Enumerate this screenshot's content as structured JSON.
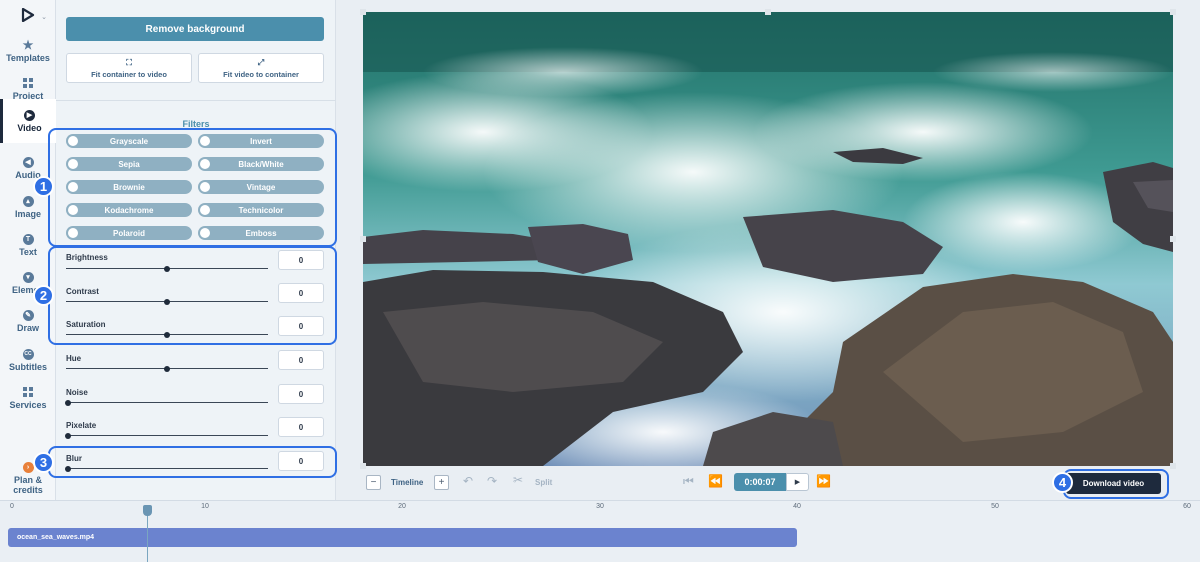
{
  "rail": {
    "items": [
      {
        "label": "Templates",
        "icon": "star-icon"
      },
      {
        "label": "Project",
        "icon": "grid-icon"
      },
      {
        "label": "Video",
        "icon": "play-icon"
      },
      {
        "label": "Audio",
        "icon": "audio-icon"
      },
      {
        "label": "Image",
        "icon": "image-icon"
      },
      {
        "label": "Text",
        "icon": "text-icon"
      },
      {
        "label": "Elemen",
        "icon": "elements-icon"
      },
      {
        "label": "Draw",
        "icon": "draw-icon"
      },
      {
        "label": "Subtitles",
        "icon": "cc-icon"
      },
      {
        "label": "Services",
        "icon": "grid-icon"
      },
      {
        "label": "Plan & credits",
        "icon": "credits-icon"
      }
    ],
    "active": "Video"
  },
  "panel": {
    "remove_bg": "Remove background",
    "fit_container": "Fit container to video",
    "fit_video": "Fit video to container",
    "filters_title": "Filters",
    "filters": [
      "Grayscale",
      "Invert",
      "Sepia",
      "Black/White",
      "Brownie",
      "Vintage",
      "Kodachrome",
      "Technicolor",
      "Polaroid",
      "Emboss"
    ],
    "sliders": {
      "brightness": {
        "label": "Brightness",
        "value": "0"
      },
      "contrast": {
        "label": "Contrast",
        "value": "0"
      },
      "saturation": {
        "label": "Saturation",
        "value": "0"
      },
      "hue": {
        "label": "Hue",
        "value": "0"
      },
      "noise": {
        "label": "Noise",
        "value": "0"
      },
      "pixelate": {
        "label": "Pixelate",
        "value": "0"
      },
      "blur": {
        "label": "Blur",
        "value": "0"
      }
    }
  },
  "annotations": [
    "1",
    "2",
    "3",
    "4"
  ],
  "controls": {
    "minus": "−",
    "plus": "+",
    "timeline_label": "Timeline",
    "split_label": "Split",
    "time": "0:00:07",
    "download": "Download video"
  },
  "timeline": {
    "ticks": [
      "0",
      "10",
      "20",
      "30",
      "40",
      "50",
      "60"
    ],
    "clip_name": "ocean_sea_waves.mp4"
  },
  "colors": {
    "accent": "#4b8fac",
    "annotation": "#2f6fe4",
    "dark": "#1e2a3d",
    "clip": "#6b83cf"
  }
}
